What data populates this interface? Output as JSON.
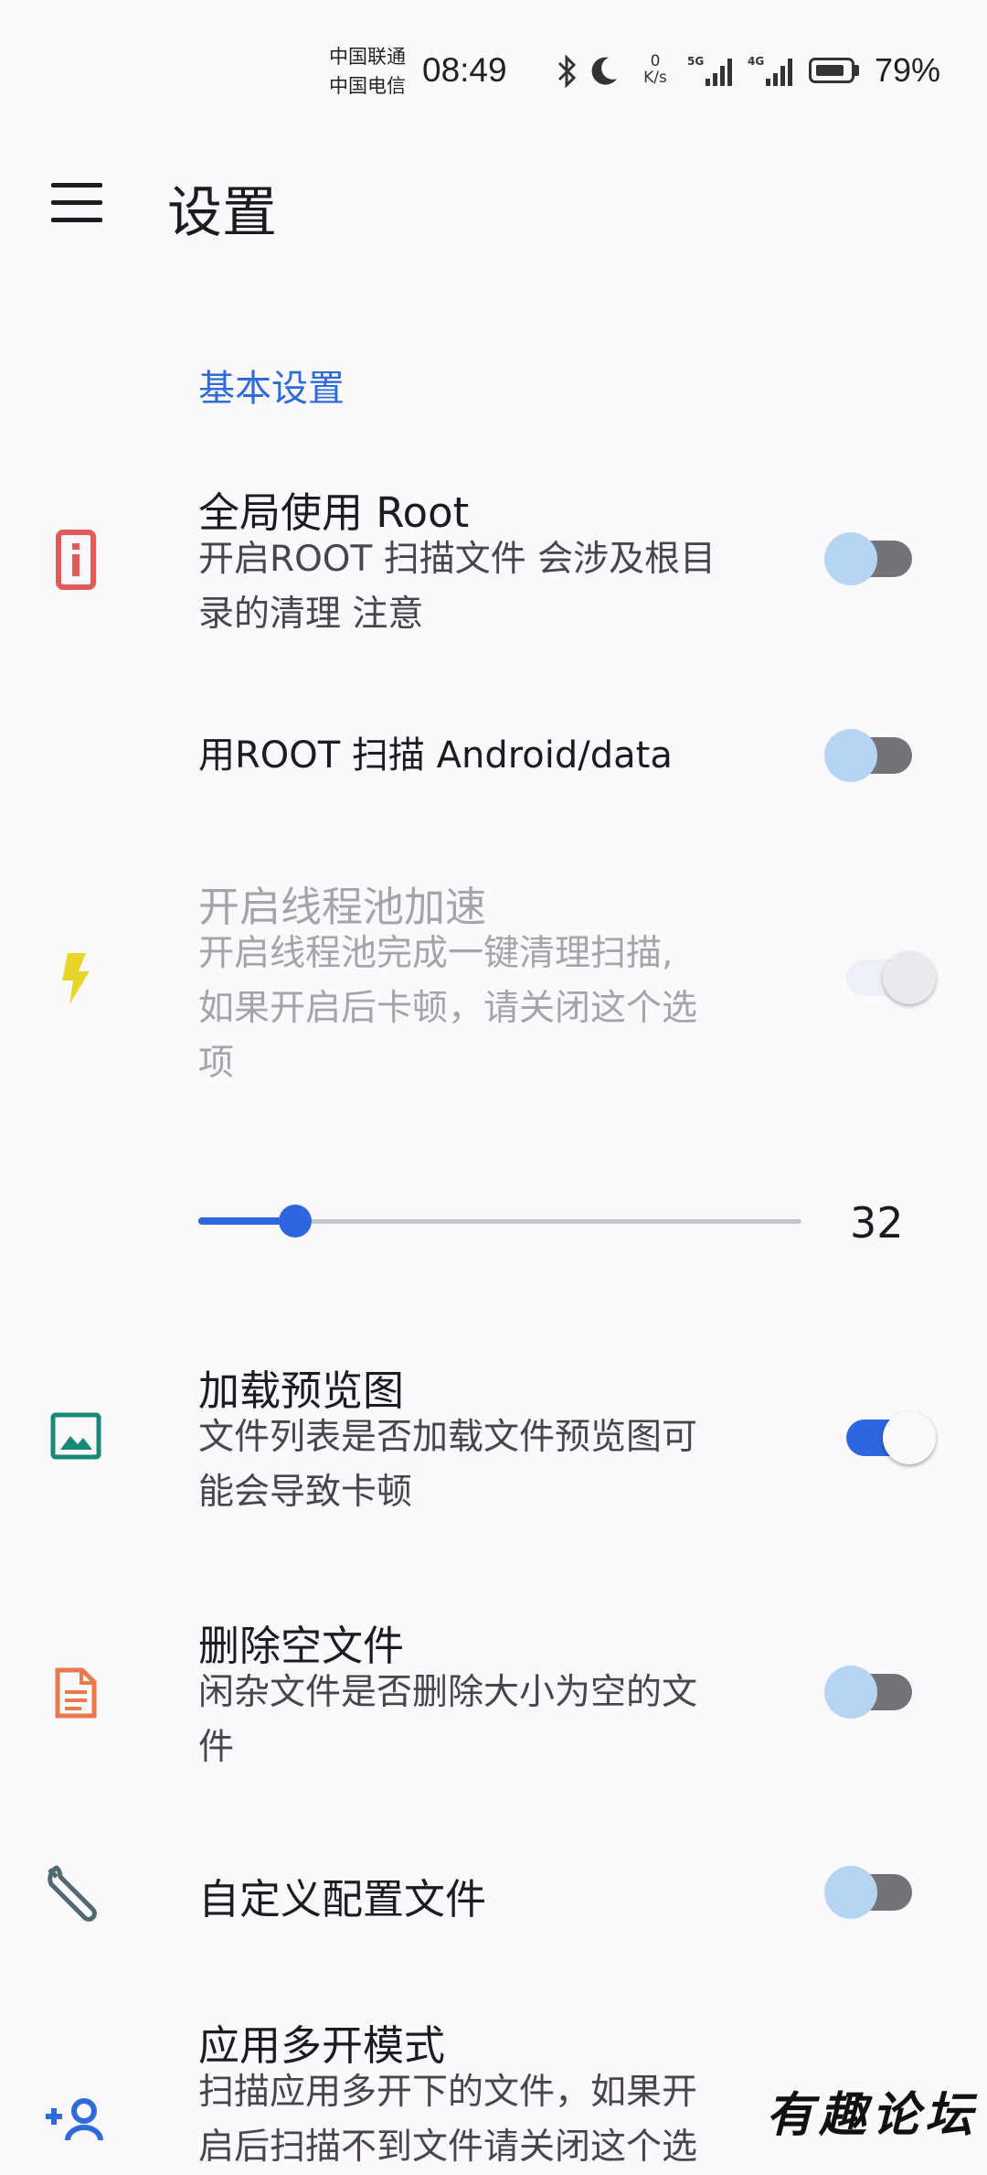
{
  "status_bar": {
    "carrier_1": "中国联通",
    "carrier_2": "中国电信",
    "time": "08:49",
    "net_speed_value": "0",
    "net_speed_unit": "K/s",
    "sim1_tech": "5G",
    "sim2_tech": "4G",
    "battery_percent": "79%",
    "battery_level": 0.79
  },
  "app_bar": {
    "title": "设置"
  },
  "section": {
    "title": "基本设置"
  },
  "settings": [
    {
      "title": "全局使用 Root",
      "subtitle_1": "开启ROOT 扫描文件 会涉及根目",
      "subtitle_2": "录的清理 注意",
      "icon": "info-icon",
      "icon_color": "#e25a5a",
      "checked": false
    },
    {
      "title": "用ROOT 扫描 Android/data",
      "checked": false
    },
    {
      "title": "开启线程池加速",
      "subtitle_1": "开启线程池完成一键清理扫描,",
      "subtitle_2": "如果开启后卡顿，请关闭这个选",
      "subtitle_3": "项",
      "icon": "lightning-icon",
      "icon_color": "#e8d52a",
      "enabled": false,
      "checked": true
    },
    {
      "title": "加载预览图",
      "subtitle_1": "文件列表是否加载文件预览图可",
      "subtitle_2": "能会导致卡顿",
      "icon": "image-icon",
      "icon_color": "#17897a",
      "checked": true
    },
    {
      "title": "删除空文件",
      "subtitle_1": "闲杂文件是否删除大小为空的文",
      "subtitle_2": "件",
      "icon": "document-icon",
      "icon_color": "#e9784a",
      "checked": false
    },
    {
      "title": "自定义配置文件",
      "icon": "wrench-icon",
      "icon_color": "#4f6a70",
      "checked": false
    },
    {
      "title": "应用多开模式",
      "subtitle_1": "扫描应用多开下的文件，如果开",
      "subtitle_2": "启后扫描不到文件请关闭这个选",
      "icon": "add-user-icon",
      "icon_color": "#2d6bdc",
      "checked": false
    }
  ],
  "thread_slider": {
    "value": "32",
    "fraction": 0.16
  },
  "watermark": "有趣论坛",
  "colors": {
    "accent": "#2e66e0",
    "section": "#2d6bdc",
    "background": "#fcf9fc"
  }
}
